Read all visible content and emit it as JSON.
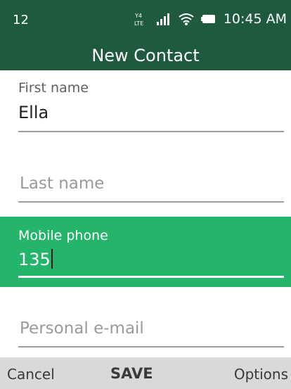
{
  "status_bar": {
    "notification_count": "12",
    "network_type": "LTE",
    "time": "10:45 AM",
    "icons": [
      "lte-volte-icon",
      "signal-icon",
      "wifi-icon",
      "battery-icon"
    ]
  },
  "header": {
    "title": "New Contact"
  },
  "form": {
    "first_name": {
      "label": "First name",
      "value": "Ella"
    },
    "last_name": {
      "placeholder": "Last name"
    },
    "mobile_phone": {
      "label": "Mobile phone",
      "value": "135"
    },
    "personal_email": {
      "placeholder": "Personal e-mail"
    }
  },
  "softkeys": {
    "left": "Cancel",
    "center": "SAVE",
    "right": "Options"
  },
  "colors": {
    "header_bg": "#1f5a3f",
    "focused_field_bg": "#24b56a",
    "softkey_bar_bg": "#d9d9d9"
  }
}
